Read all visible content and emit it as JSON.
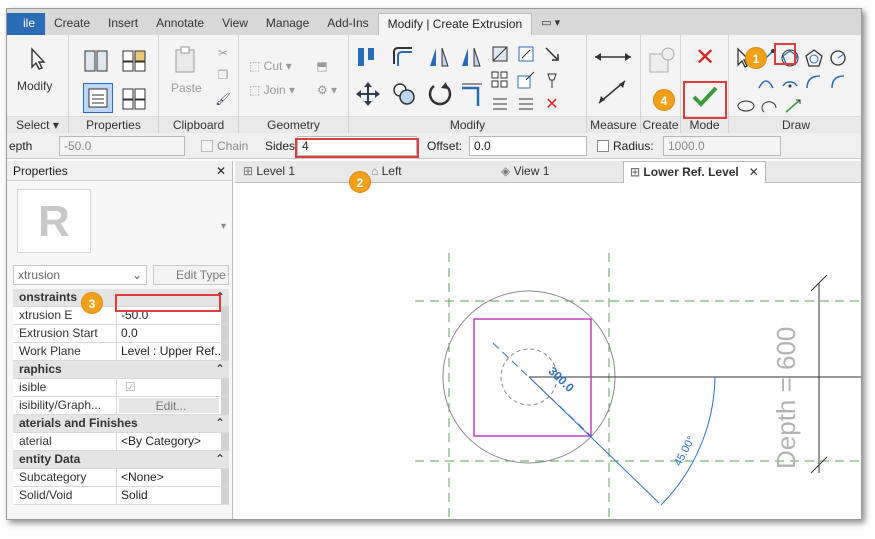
{
  "ribbon_tabs": [
    "ile",
    "Create",
    "Insert",
    "Annotate",
    "View",
    "Manage",
    "Add-Ins",
    "Modify | Create Extrusion"
  ],
  "panels": {
    "select": {
      "modify_label": "Modify",
      "title": "Select"
    },
    "properties": {
      "title": "Properties"
    },
    "clipboard": {
      "paste_label": "Paste",
      "title": "Clipboard"
    },
    "geometry": {
      "cut_label": "Cut",
      "join_label": "Join",
      "title": "Geometry"
    },
    "modify": {
      "title": "Modify"
    },
    "measure": {
      "title": "Measure"
    },
    "create": {
      "title": "Create"
    },
    "mode": {
      "title": "Mode"
    },
    "draw": {
      "title": "Draw"
    }
  },
  "options_bar": {
    "depth_label": "epth",
    "depth_value": "-50.0",
    "chain_label": "Chain",
    "sides_label": "Sides:",
    "sides_value": "4",
    "offset_label": "Offset:",
    "offset_value": "0.0",
    "radius_label": "Radius:",
    "radius_value": "1000.0"
  },
  "properties_panel": {
    "title": "Properties",
    "type_selector": "xtrusion",
    "edit_type_label": "Edit Type",
    "rows": [
      {
        "section": true,
        "key": "onstraints"
      },
      {
        "key": "xtrusion E",
        "value": "-50.0"
      },
      {
        "key": "Extrusion Start",
        "value": "0.0"
      },
      {
        "key": "Work Plane",
        "value": "Level : Upper Ref..."
      },
      {
        "section": true,
        "key": "raphics"
      },
      {
        "key": "isible",
        "value": ""
      },
      {
        "key": "isibility/Graph...",
        "value": "Edit..."
      },
      {
        "section": true,
        "key": "aterials and Finishes"
      },
      {
        "key": "aterial",
        "value": "<By Category>"
      },
      {
        "section": true,
        "key": "entity Data"
      },
      {
        "key": "Subcategory",
        "value": "<None>"
      },
      {
        "key": "Solid/Void",
        "value": "Solid"
      }
    ]
  },
  "view_tabs": [
    "Level 1",
    "Left",
    "View 1",
    "Lower Ref. Level"
  ],
  "canvas": {
    "dimension_value": "300.0",
    "angle_value": "45.00°",
    "depth_label": "Depth = 600"
  },
  "callouts": [
    "1",
    "2",
    "3",
    "4"
  ],
  "colors": {
    "accent_red": "#e23b3b",
    "badge": "#f2a019",
    "sketch_magenta": "#c23fc4",
    "dimension_blue": "#2d72c8"
  }
}
